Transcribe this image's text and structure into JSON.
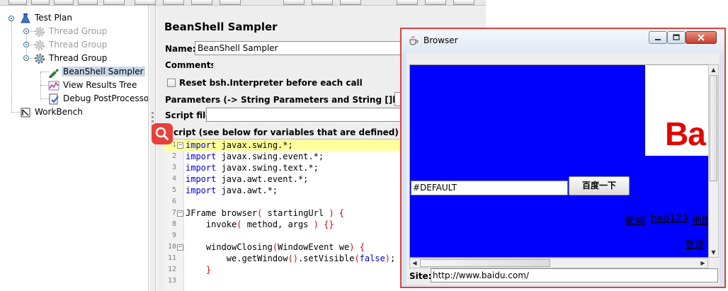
{
  "tree": {
    "items": [
      {
        "label": "Test Plan",
        "icon": "test-plan-icon",
        "state": "normal"
      },
      {
        "label": "Thread Group",
        "icon": "gear-icon",
        "state": "disabled"
      },
      {
        "label": "Thread Group",
        "icon": "gear-icon",
        "state": "disabled"
      },
      {
        "label": "Thread Group",
        "icon": "gear-icon",
        "state": "normal"
      },
      {
        "label": "BeanShell Sampler",
        "icon": "pipette-icon",
        "state": "selected"
      },
      {
        "label": "View Results Tree",
        "icon": "chart-icon",
        "state": "normal"
      },
      {
        "label": "Debug PostProcessor",
        "icon": "debug-icon",
        "state": "normal"
      },
      {
        "label": "WorkBench",
        "icon": "workbench-icon",
        "state": "normal"
      }
    ]
  },
  "sampler": {
    "title": "BeanShell Sampler",
    "name_label": "Name:",
    "name_value": "BeanShell Sampler",
    "comments_label": "Comments:",
    "reset_label": "Reset bsh.Interpreter before each call",
    "params_label": "Parameters (-> String Parameters and String []bsh.args)",
    "scriptfile_label": "Script file",
    "script_label": "Script (see below for variables that are defined)",
    "script_label_visible": "cript (see below for variables that are defined)"
  },
  "code": {
    "lines": [
      {
        "n": "1",
        "fold": "⊟",
        "tokens": [
          [
            "kw",
            "import"
          ],
          [
            "tx",
            " javax.swing.*;"
          ]
        ],
        "highlight": true
      },
      {
        "n": "2",
        "fold": "",
        "tokens": [
          [
            "kw",
            "import"
          ],
          [
            "tx",
            " javax.swing.event.*;"
          ]
        ],
        "highlight": false
      },
      {
        "n": "3",
        "fold": "",
        "tokens": [
          [
            "kw",
            "import"
          ],
          [
            "tx",
            " javax.swing.text.*;"
          ]
        ],
        "highlight": false
      },
      {
        "n": "4",
        "fold": "",
        "tokens": [
          [
            "kw",
            "import"
          ],
          [
            "tx",
            " java.awt.event.*;"
          ]
        ],
        "highlight": false
      },
      {
        "n": "5",
        "fold": "",
        "tokens": [
          [
            "kw",
            "import"
          ],
          [
            "tx",
            " java.awt.*;"
          ]
        ],
        "highlight": false
      },
      {
        "n": "6",
        "fold": "",
        "tokens": [],
        "highlight": false
      },
      {
        "n": "7",
        "fold": "⊟",
        "tokens": [
          [
            "tx",
            "JFrame browser"
          ],
          [
            "pn",
            "("
          ],
          [
            "tx",
            " startingUrl "
          ],
          [
            "pn",
            ")"
          ],
          [
            "tx",
            " "
          ],
          [
            "pn",
            "{"
          ]
        ],
        "highlight": false
      },
      {
        "n": "8",
        "fold": "",
        "tokens": [
          [
            "tx",
            "    invoke"
          ],
          [
            "pn",
            "("
          ],
          [
            "tx",
            " method, args "
          ],
          [
            "pn",
            ")"
          ],
          [
            "tx",
            " "
          ],
          [
            "pn",
            "{}"
          ]
        ],
        "highlight": false
      },
      {
        "n": "9",
        "fold": "",
        "tokens": [],
        "highlight": false
      },
      {
        "n": "10",
        "fold": "⊟",
        "tokens": [
          [
            "tx",
            "    windowClosing"
          ],
          [
            "pn",
            "("
          ],
          [
            "tx",
            "WindowEvent we"
          ],
          [
            "pn",
            ")"
          ],
          [
            "tx",
            " "
          ],
          [
            "pn",
            "{"
          ]
        ],
        "highlight": false
      },
      {
        "n": "11",
        "fold": "",
        "tokens": [
          [
            "tx",
            "        we.getWindow"
          ],
          [
            "pn",
            "()"
          ],
          [
            "tx",
            ".setVisible"
          ],
          [
            "pn",
            "("
          ],
          [
            "kw",
            "false"
          ],
          [
            "pn",
            ")"
          ],
          [
            "tx",
            ";"
          ]
        ],
        "highlight": false
      },
      {
        "n": "12",
        "fold": "",
        "tokens": [
          [
            "pn",
            "    }"
          ]
        ],
        "highlight": false
      },
      {
        "n": "13",
        "fold": "",
        "tokens": [],
        "highlight": false
      }
    ]
  },
  "browser": {
    "title": "Browser",
    "page": {
      "input_value": "#DEFAULT",
      "search_button": "百度一下",
      "logo_text": "Ba",
      "links": [
        "新闻",
        "hao123",
        "地图"
      ],
      "login": "登录"
    },
    "site_label": "Site:",
    "site_value": "http://www.baidu.com/",
    "colors": {
      "page_bg": "#0000ff",
      "logo": "#e10602",
      "frame": "#e0403d"
    }
  },
  "colors": {
    "selection": "#c7d7ea",
    "line_highlight": "#ffff9e",
    "keyword": "#0000cc",
    "paren": "#e00000"
  }
}
